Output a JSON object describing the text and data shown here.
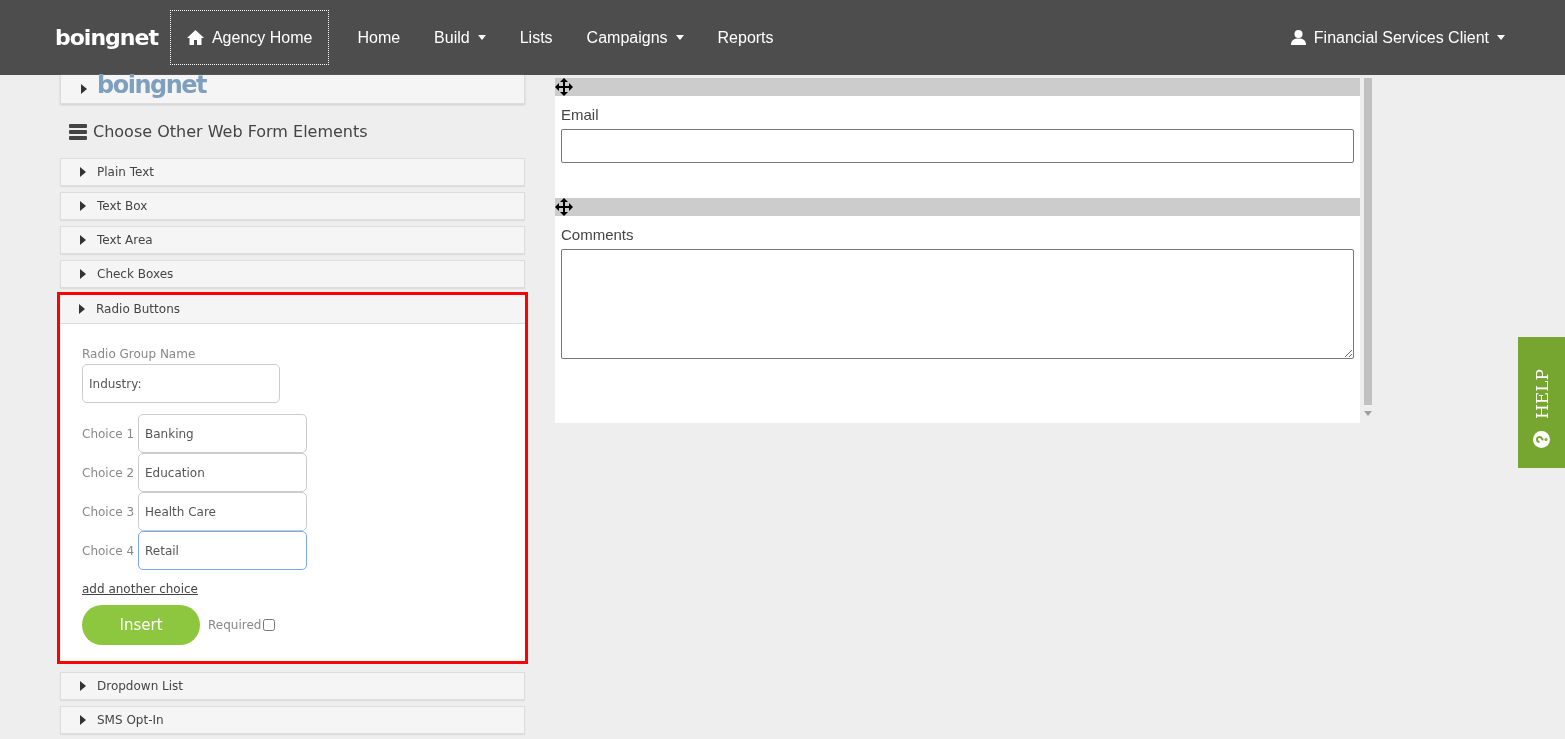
{
  "nav": {
    "brand": "boingnet",
    "items": [
      {
        "label": "Agency Home",
        "kind": "home",
        "focused": true
      },
      {
        "label": "Home",
        "kind": "link",
        "focused": false
      },
      {
        "label": "Build",
        "kind": "dropdown",
        "focused": false
      },
      {
        "label": "Lists",
        "kind": "link",
        "focused": false
      },
      {
        "label": "Campaigns",
        "kind": "dropdown",
        "focused": false
      },
      {
        "label": "Reports",
        "kind": "link",
        "focused": false
      }
    ],
    "user": "Financial Services Client"
  },
  "sidebar": {
    "logo_panel": {
      "logo": "boingnet"
    },
    "heading": "Choose Other Web Form Elements",
    "elements": [
      {
        "label": "Plain Text",
        "expanded": false,
        "highlighted": false
      },
      {
        "label": "Text Box",
        "expanded": false,
        "highlighted": false
      },
      {
        "label": "Text Area",
        "expanded": false,
        "highlighted": false
      },
      {
        "label": "Check Boxes",
        "expanded": false,
        "highlighted": false
      },
      {
        "label": "Radio Buttons",
        "expanded": true,
        "highlighted": true
      },
      {
        "label": "Dropdown List",
        "expanded": false,
        "highlighted": false
      },
      {
        "label": "SMS Opt-In",
        "expanded": false,
        "highlighted": false
      }
    ]
  },
  "radio_form": {
    "group_label": "Radio Group Name",
    "group_value": "Industry:",
    "choices": [
      {
        "label": "Choice 1",
        "value": "Banking",
        "focused": false
      },
      {
        "label": "Choice 2",
        "value": "Education",
        "focused": false
      },
      {
        "label": "Choice 3",
        "value": "Health Care",
        "focused": false
      },
      {
        "label": "Choice 4",
        "value": "Retail",
        "focused": true
      }
    ],
    "add_link": "add another choice",
    "insert_button": "Insert",
    "required_label": "Required",
    "required": false
  },
  "canvas": {
    "fields": [
      {
        "label": "Email",
        "kind": "input"
      },
      {
        "label": "Comments",
        "kind": "textarea"
      }
    ]
  },
  "help_tab": {
    "label": "HELP"
  }
}
